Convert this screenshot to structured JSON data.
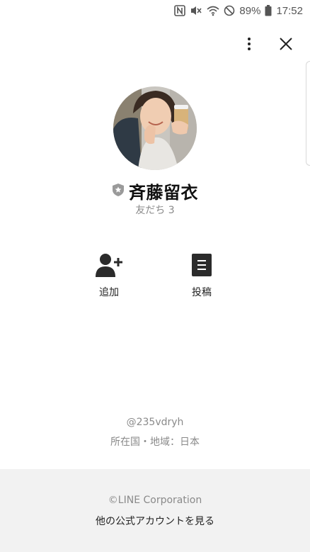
{
  "status_bar": {
    "battery": "89%",
    "time": "17:52",
    "icons": [
      "nfc-icon",
      "vibrate-mute-icon",
      "wifi-icon",
      "do-not-disturb-icon",
      "battery-icon"
    ]
  },
  "top_actions": {
    "icons": [
      "more-vertical-icon",
      "close-icon"
    ]
  },
  "profile": {
    "name": "斉藤留衣",
    "badge_icon": "shield-badge-icon",
    "friends_text": "友だち 3"
  },
  "actions": [
    {
      "label": "追加",
      "icon": "add-friend-icon"
    },
    {
      "label": "投稿",
      "icon": "post-icon"
    }
  ],
  "meta": {
    "line_id": "@235vdryh",
    "location": "所在国・地域：日本"
  },
  "footer": {
    "copyright": "©LINE Corporation",
    "more_link": "他の公式アカウントを見る"
  },
  "colors": {
    "text_primary": "#222222",
    "text_secondary": "#8a8a8a",
    "footer_bg": "#f2f2f2",
    "icon_dark": "#2b2b2b"
  }
}
